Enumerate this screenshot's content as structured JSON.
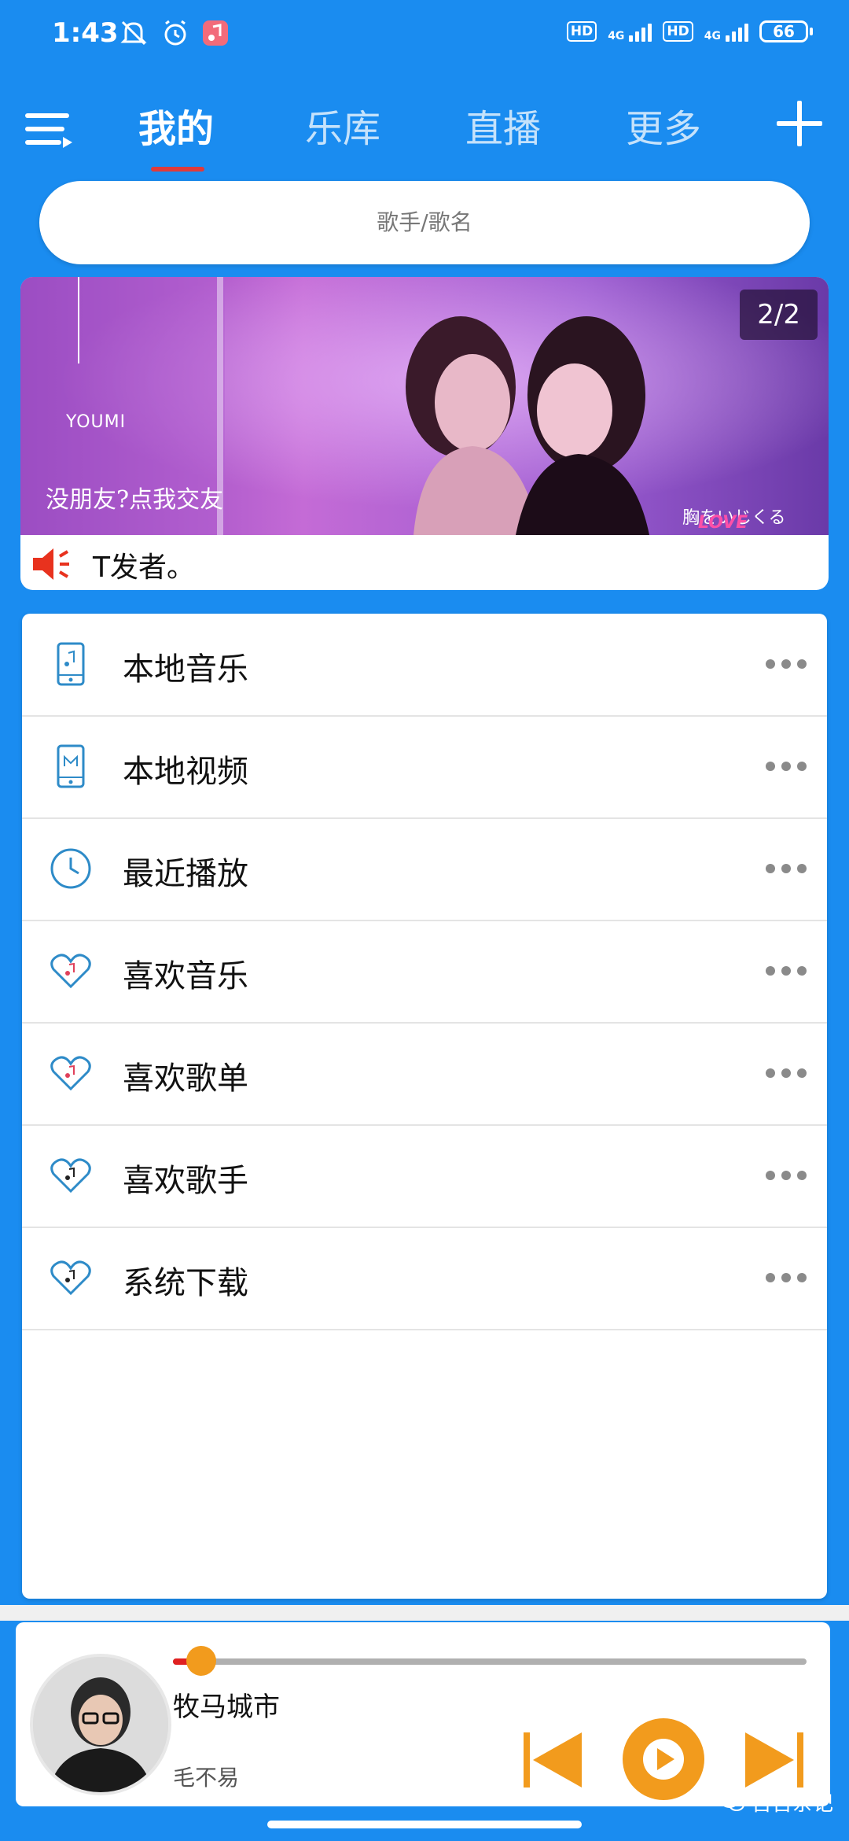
{
  "status_bar": {
    "time": "1:43",
    "net1": "4G",
    "net2": "4G",
    "hd": "HD",
    "battery": "66"
  },
  "nav": {
    "tabs": [
      {
        "label": "我的",
        "active": true
      },
      {
        "label": "乐库",
        "active": false
      },
      {
        "label": "直播",
        "active": false
      },
      {
        "label": "更多",
        "active": false
      }
    ]
  },
  "search": {
    "placeholder": "歌手/歌名"
  },
  "banner": {
    "counter": "2/2",
    "logo_text": "YOUMI",
    "caption_left": "没朋友?点我交友",
    "caption_right": "胸をいじくる",
    "caption_love": "LOVE",
    "ticker": "T发者。"
  },
  "list": {
    "items": [
      {
        "label": "本地音乐",
        "icon": "phone-music-icon"
      },
      {
        "label": "本地视频",
        "icon": "phone-video-icon"
      },
      {
        "label": "最近播放",
        "icon": "clock-icon"
      },
      {
        "label": "喜欢音乐",
        "icon": "heart-music-icon"
      },
      {
        "label": "喜欢歌单",
        "icon": "heart-music-icon"
      },
      {
        "label": "喜欢歌手",
        "icon": "heart-music-icon"
      },
      {
        "label": "系统下载",
        "icon": "heart-music-icon"
      }
    ]
  },
  "player": {
    "title": "牧马城市",
    "artist": "毛不易",
    "progress": 0.045
  },
  "watermark": "吾吾杂记",
  "colors": {
    "primary": "#1a8cf0",
    "accent": "#f29b1d",
    "tab_indicator": "#e03a3a",
    "icon_blue": "#2e8bc8"
  }
}
